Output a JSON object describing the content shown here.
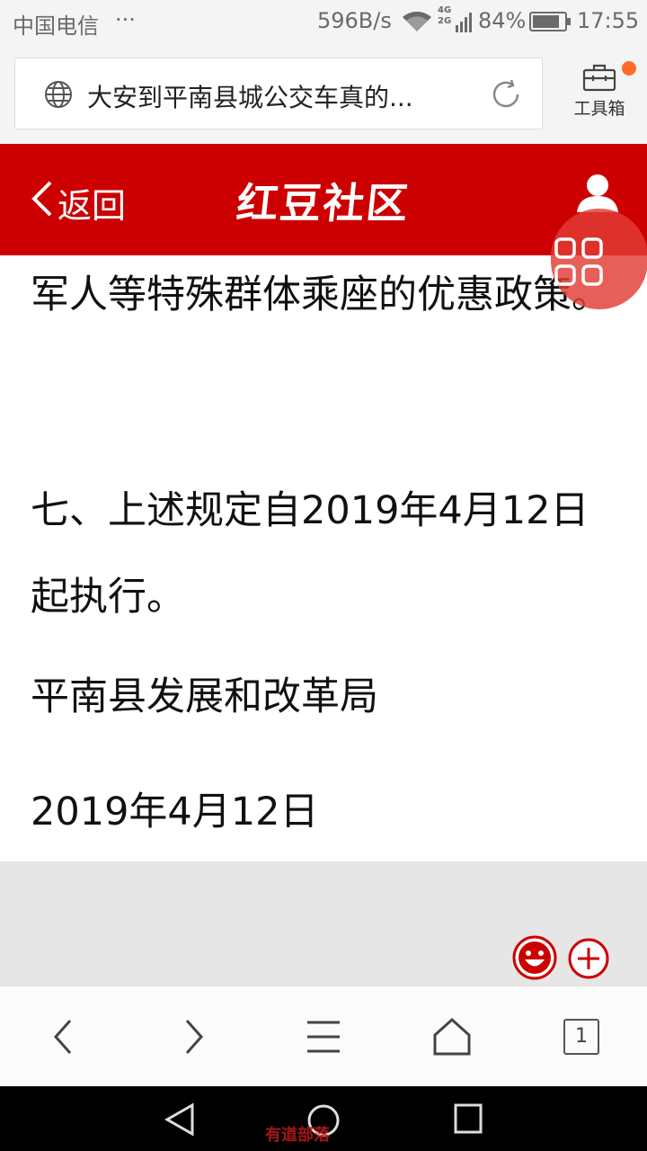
{
  "status_bar": {
    "carrier": "中国电信",
    "dots": "···",
    "speed": "596B/s",
    "network_top": "4G",
    "network_bottom": "2G",
    "battery_pct": "84%",
    "battery_level": 0.84,
    "time": "17:55"
  },
  "browser": {
    "url_title": "大安到平南县城公交车真的...",
    "toolbox_label": "工具箱",
    "icons": {
      "site": "globe-icon",
      "reload": "reload-icon",
      "toolbox": "toolbox-icon"
    }
  },
  "site_header": {
    "back_label": "返回",
    "logo_text": "红豆社区",
    "icons": {
      "back": "chevron-left-icon",
      "user": "user-icon",
      "float": "grid-icon"
    }
  },
  "article": {
    "paragraphs": [
      "军人等特殊群体乘座的优惠政策。",
      "七、上述规定自2019年4月12日起执行。",
      "平南县发展和改革局",
      "2019年4月12日"
    ]
  },
  "actions": {
    "icons": [
      "smile-icon",
      "plus-icon"
    ]
  },
  "bottom_nav": {
    "tab_count": "1"
  },
  "watermark": "有道部落",
  "colors": {
    "brand_red": "#cc0000",
    "float_red": "#e23c34",
    "badge_orange": "#ff6a2a"
  }
}
